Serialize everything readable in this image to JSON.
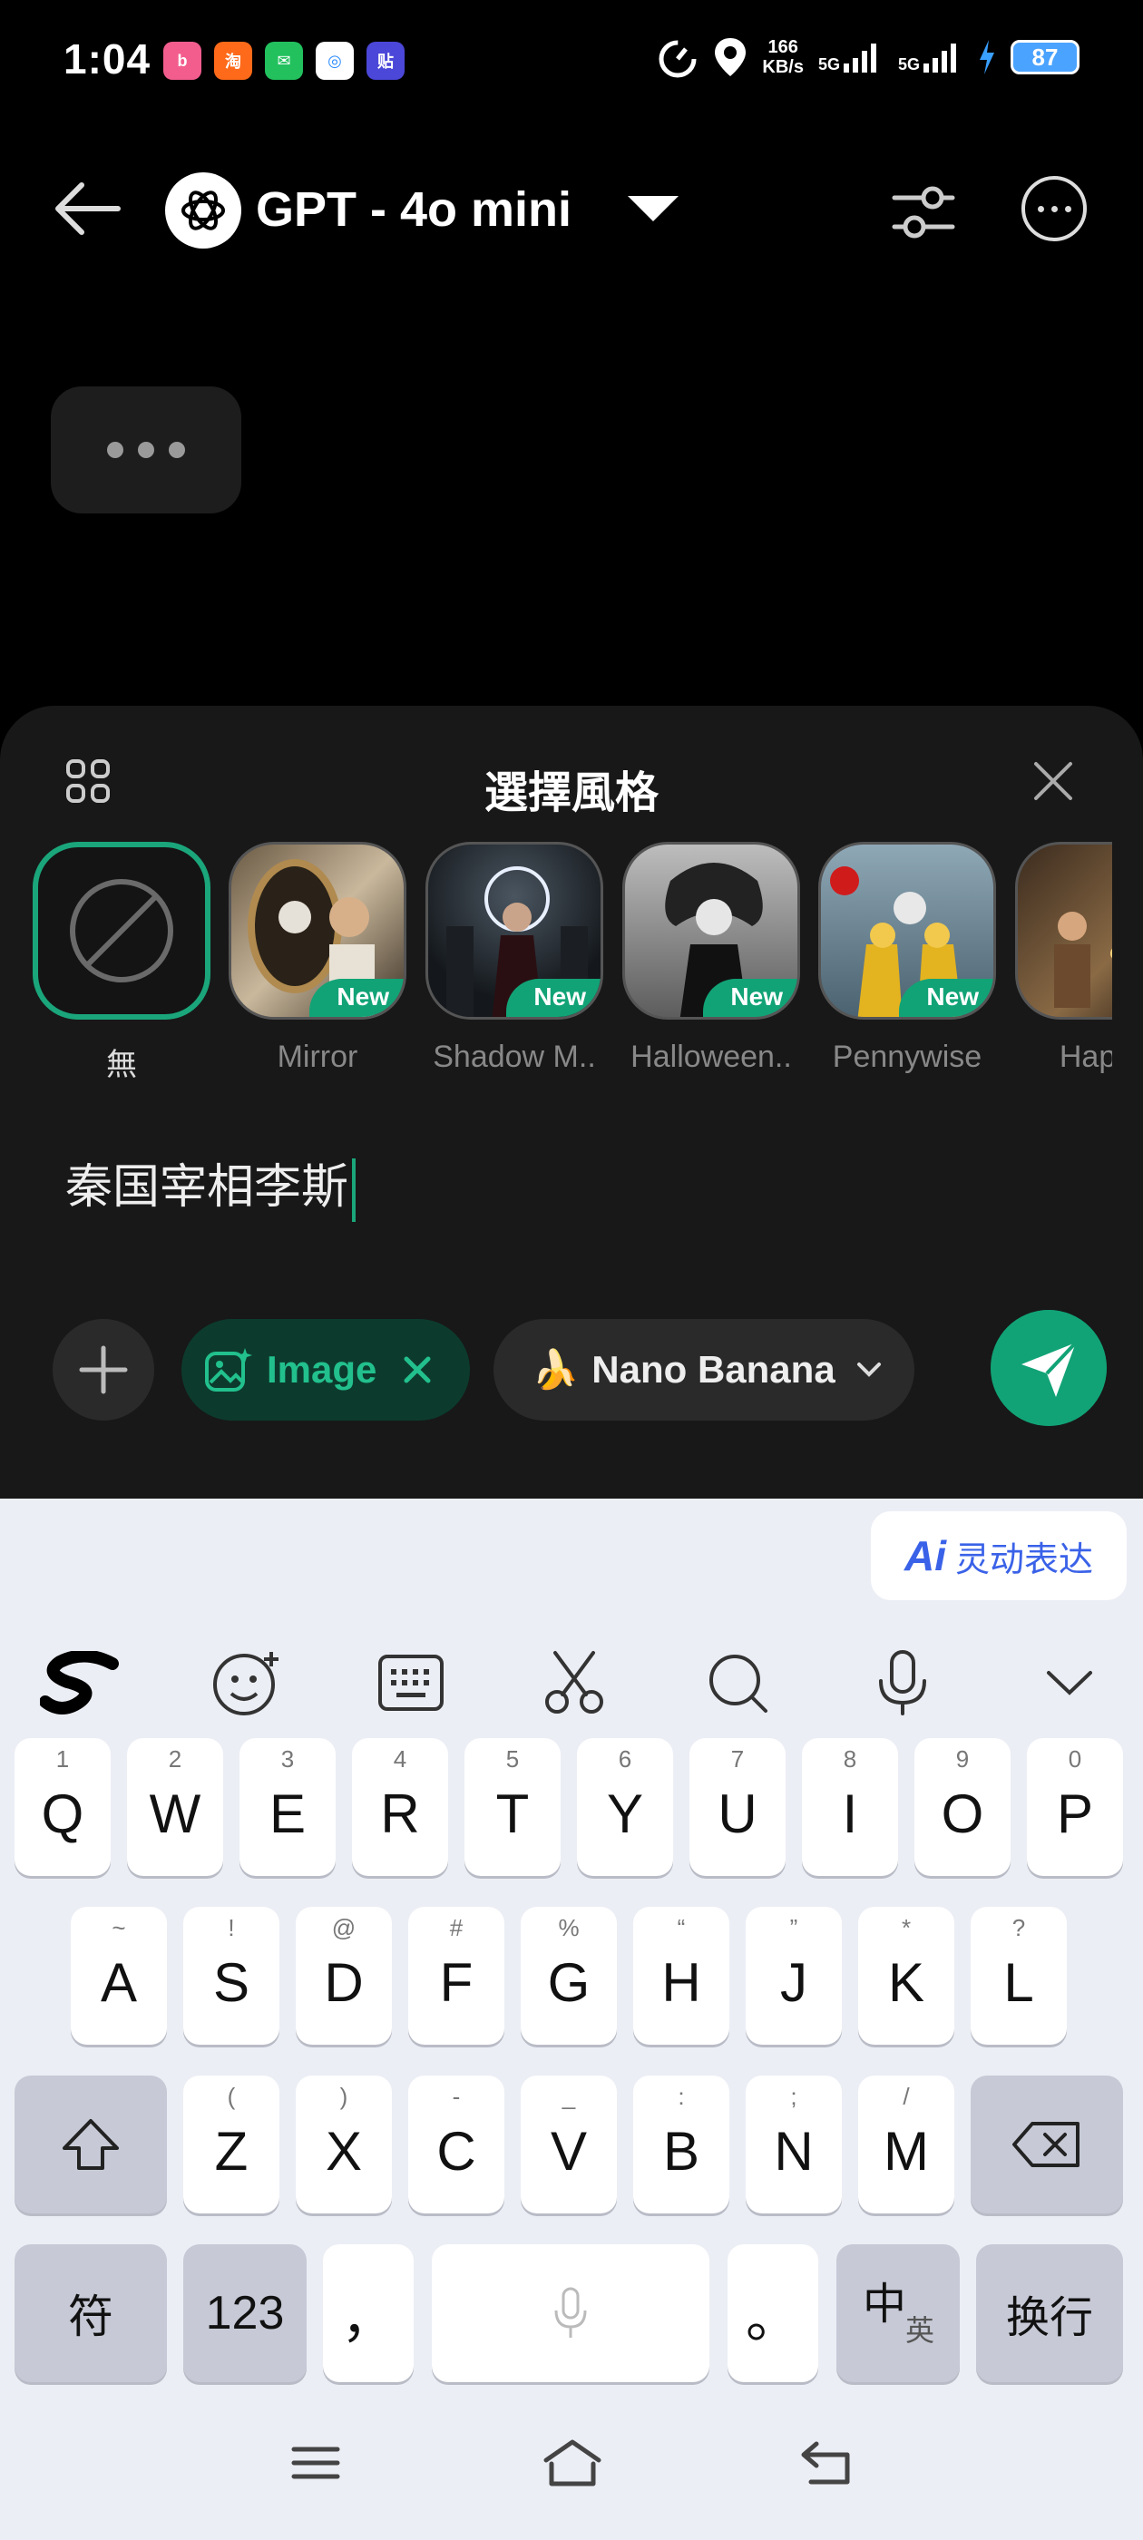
{
  "status": {
    "time": "1:04",
    "speed_value": "166",
    "speed_unit": "KB/s",
    "net1": "5G",
    "net2": "5G",
    "battery": "87",
    "app_icons": [
      "bilibili-icon",
      "taobao-icon",
      "wechat-icon",
      "alipay-icon",
      "tieba-icon"
    ]
  },
  "header": {
    "model_name": "GPT - 4o mini"
  },
  "sheet": {
    "title": "選擇風格",
    "styles": [
      {
        "label": "無",
        "badge": "",
        "selected": true
      },
      {
        "label": "Mirror",
        "badge": "New"
      },
      {
        "label": "Shadow M..",
        "badge": "New"
      },
      {
        "label": "Halloween..",
        "badge": "New"
      },
      {
        "label": "Pennywise",
        "badge": "New"
      },
      {
        "label": "Happy",
        "badge": ""
      }
    ],
    "prompt_text": "秦国宰相李斯",
    "image_chip": "Image",
    "model_chip": "Nano Banana",
    "model_chip_emoji": "🍌",
    "accent": "#11a376"
  },
  "keyboard": {
    "ai_label": "Ai",
    "ai_text": "灵动表达",
    "row1": [
      [
        "1",
        "Q"
      ],
      [
        "2",
        "W"
      ],
      [
        "3",
        "E"
      ],
      [
        "4",
        "R"
      ],
      [
        "5",
        "T"
      ],
      [
        "6",
        "Y"
      ],
      [
        "7",
        "U"
      ],
      [
        "8",
        "I"
      ],
      [
        "9",
        "O"
      ],
      [
        "0",
        "P"
      ]
    ],
    "row2": [
      [
        "~",
        "A"
      ],
      [
        "!",
        "S"
      ],
      [
        "@",
        "D"
      ],
      [
        "#",
        "F"
      ],
      [
        "%",
        "G"
      ],
      [
        "“",
        "H"
      ],
      [
        "”",
        "J"
      ],
      [
        "*",
        "K"
      ],
      [
        "?",
        "L"
      ]
    ],
    "row3": [
      [
        "(",
        "Z"
      ],
      [
        ")",
        "X"
      ],
      [
        "-",
        "C"
      ],
      [
        "_",
        "V"
      ],
      [
        ":",
        "B"
      ],
      [
        ";",
        "N"
      ],
      [
        "/",
        "M"
      ]
    ],
    "sym_key": "符",
    "num_key": "123",
    "comma_key": "，",
    "period_key": "。",
    "lang_main": "中",
    "lang_sub": "英",
    "enter_key": "换行"
  }
}
